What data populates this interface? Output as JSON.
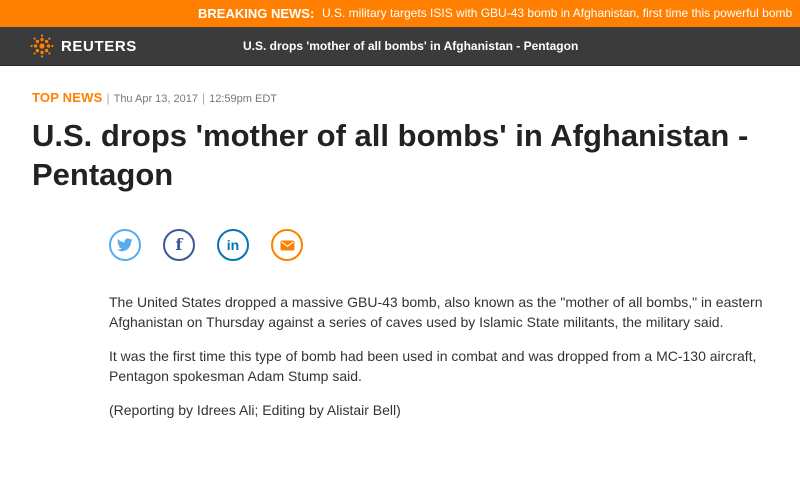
{
  "breaking": {
    "label": "BREAKING NEWS:",
    "text": "U.S. military targets ISIS with GBU-43 bomb in Afghanistan, first time this powerful bomb"
  },
  "nav": {
    "logo_text": "REUTERS",
    "article_title": "U.S. drops 'mother of all bombs' in Afghanistan - Pentagon"
  },
  "article": {
    "section": "TOP NEWS",
    "date": "Thu Apr 13, 2017",
    "time": "12:59pm EDT",
    "headline": "U.S. drops 'mother of all bombs' in Afghanistan - Pentagon",
    "share": [
      {
        "name": "twitter",
        "icon": "twitter-icon",
        "color": "#55acee"
      },
      {
        "name": "facebook",
        "icon": "facebook-icon",
        "color": "#3b5998"
      },
      {
        "name": "linkedin",
        "icon": "linkedin-icon",
        "color": "#0077b5"
      },
      {
        "name": "email",
        "icon": "email-icon",
        "color": "#ff8000"
      }
    ],
    "paragraphs": [
      "The United States dropped a massive GBU-43 bomb, also known as the \"mother of all bombs,\" in eastern Afghanistan on Thursday against a series of caves used by Islamic State militants, the military said.",
      "It was the first time this type of bomb had been used in combat and was dropped from a MC-130 aircraft, Pentagon spokesman Adam Stump said.",
      "(Reporting by Idrees Ali; Editing by Alistair Bell)"
    ]
  },
  "colors": {
    "accent": "#ff8000",
    "navbar": "#3b3b3b"
  }
}
